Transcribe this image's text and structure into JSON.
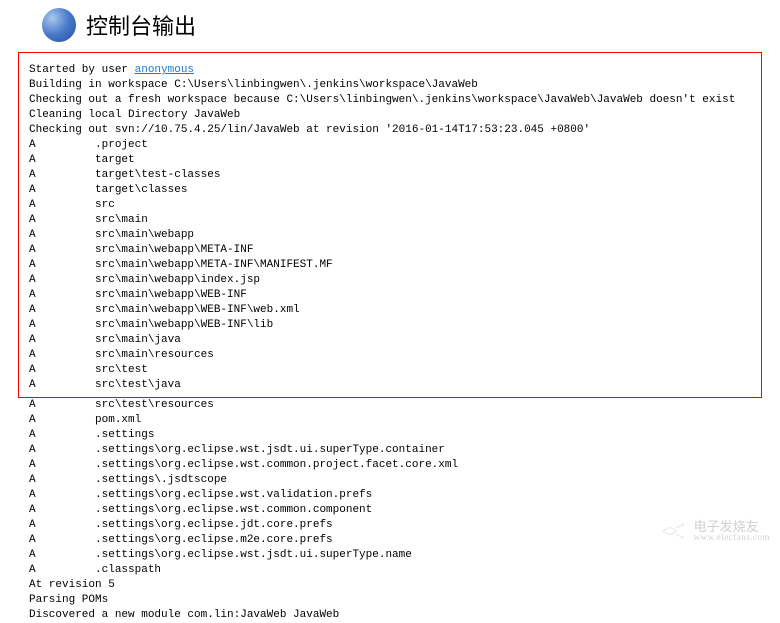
{
  "header": {
    "title": "控制台输出"
  },
  "console": {
    "started_prefix": "Started by user ",
    "started_user": "anonymous",
    "line_building": "Building in workspace C:\\Users\\linbingwen\\.jenkins\\workspace\\JavaWeb",
    "line_checking_fresh": "Checking out a fresh workspace because C:\\Users\\linbingwen\\.jenkins\\workspace\\JavaWeb\\JavaWeb doesn't exist",
    "line_cleaning": "Cleaning local Directory JavaWeb",
    "line_svn": "Checking out svn://10.75.4.25/lin/JavaWeb at revision '2016-01-14T17:53:23.045 +0800'",
    "boxed_rows": [
      ".project",
      "target",
      "target\\test-classes",
      "target\\classes",
      "src",
      "src\\main",
      "src\\main\\webapp",
      "src\\main\\webapp\\META-INF",
      "src\\main\\webapp\\META-INF\\MANIFEST.MF",
      "src\\main\\webapp\\index.jsp",
      "src\\main\\webapp\\WEB-INF",
      "src\\main\\webapp\\WEB-INF\\web.xml",
      "src\\main\\webapp\\WEB-INF\\lib",
      "src\\main\\java",
      "src\\main\\resources",
      "src\\test",
      "src\\test\\java"
    ],
    "rest_rows": [
      "src\\test\\resources",
      "pom.xml",
      ".settings",
      ".settings\\org.eclipse.wst.jsdt.ui.superType.container",
      ".settings\\org.eclipse.wst.common.project.facet.core.xml",
      ".settings\\.jsdtscope",
      ".settings\\org.eclipse.wst.validation.prefs",
      ".settings\\org.eclipse.wst.common.component",
      ".settings\\org.eclipse.jdt.core.prefs",
      ".settings\\org.eclipse.m2e.core.prefs",
      ".settings\\org.eclipse.wst.jsdt.ui.superType.name",
      ".classpath"
    ],
    "row_prefix": "A         ",
    "tail_lines": [
      "At revision 5",
      "Parsing POMs",
      "Discovered a new module com.lin:JavaWeb JavaWeb"
    ]
  },
  "watermark": {
    "line1": "电子发烧友",
    "line2": "www.elecfans.com"
  }
}
